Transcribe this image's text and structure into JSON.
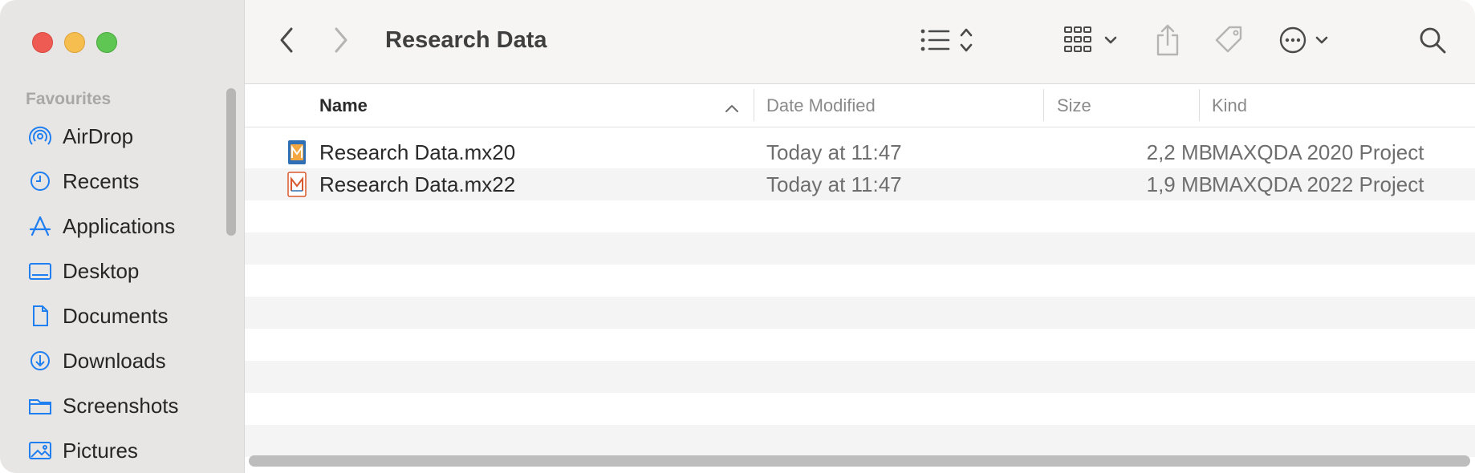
{
  "window": {
    "title": "Research Data"
  },
  "sidebar": {
    "section_title": "Favourites",
    "items": [
      {
        "label": "AirDrop",
        "icon": "airdrop-icon"
      },
      {
        "label": "Recents",
        "icon": "clock-icon"
      },
      {
        "label": "Applications",
        "icon": "applications-icon"
      },
      {
        "label": "Desktop",
        "icon": "desktop-icon"
      },
      {
        "label": "Documents",
        "icon": "document-icon"
      },
      {
        "label": "Downloads",
        "icon": "download-icon"
      },
      {
        "label": "Screenshots",
        "icon": "folder-icon"
      },
      {
        "label": "Pictures",
        "icon": "pictures-icon"
      }
    ]
  },
  "columns": {
    "name": "Name",
    "date": "Date Modified",
    "size": "Size",
    "kind": "Kind"
  },
  "files": [
    {
      "name": "Research Data.mx20",
      "date": "Today at 11:47",
      "size": "2,2 MB",
      "kind": "MAXQDA 2020 Project",
      "icon": "maxqda-2020-icon"
    },
    {
      "name": "Research Data.mx22",
      "date": "Today at 11:47",
      "size": "1,9 MB",
      "kind": "MAXQDA 2022 Project",
      "icon": "maxqda-2022-icon"
    }
  ],
  "colors": {
    "accent": "#1f7ef0",
    "sidebar_bg": "#e8e6e5"
  }
}
